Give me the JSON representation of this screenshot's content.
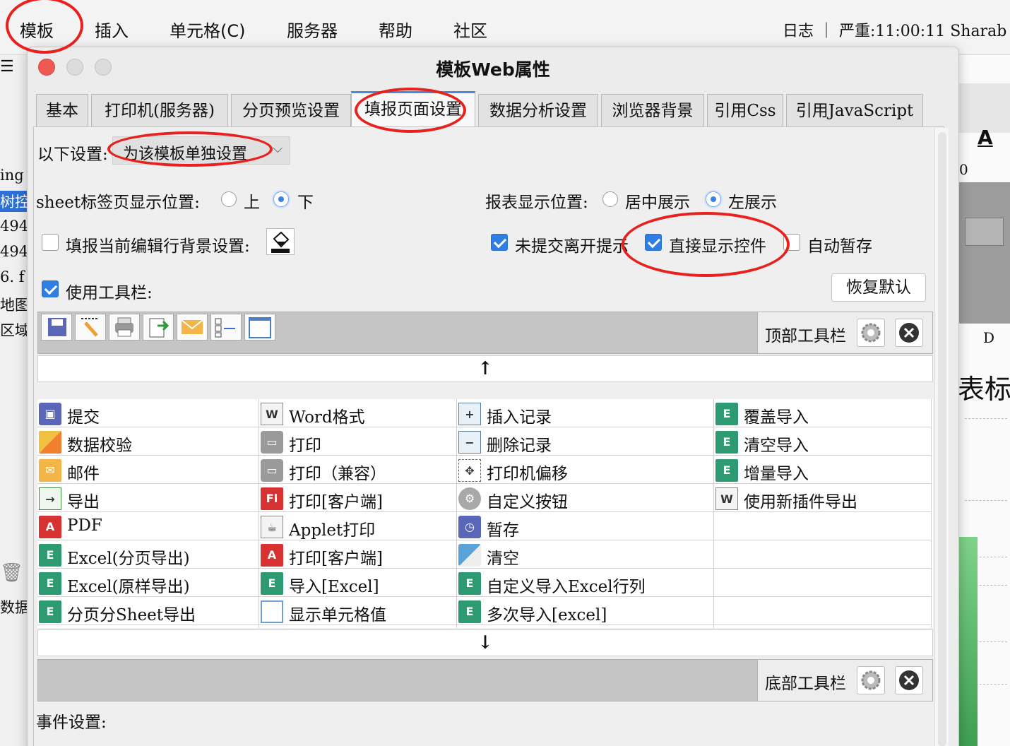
{
  "menubar": {
    "items": [
      "模板",
      "插入",
      "单元格(C)",
      "服务器",
      "帮助",
      "社区"
    ],
    "right_text": "日志 ｜ 严重:11:00:11 Sharab"
  },
  "background": {
    "left_fragments": [
      "ing",
      "树控",
      "494",
      "494",
      "6. f",
      "地图",
      "区域",
      "数据"
    ],
    "right_fragments": [
      "A",
      "0",
      "D",
      "表标题"
    ]
  },
  "dialog": {
    "title": "模板Web属性",
    "tabs": [
      "基本",
      "打印机(服务器)",
      "分页预览设置",
      "填报页面设置",
      "数据分析设置",
      "浏览器背景",
      "引用Css",
      "引用JavaScript"
    ],
    "active_tab": "填报页面设置"
  },
  "settings": {
    "scope_label": "以下设置:",
    "scope_value": "为该模板单独设置",
    "sheet_pos_label": "sheet标签页显示位置:",
    "sheet_pos_up": "上",
    "sheet_pos_down": "下",
    "sheet_pos_selected": "下",
    "report_pos_label": "报表显示位置:",
    "report_center": "居中展示",
    "report_left": "左展示",
    "report_selected": "左展示",
    "bg_setting_label": "填报当前编辑行背景设置:",
    "bg_setting_checked": false,
    "leave_prompt_label": "未提交离开提示",
    "leave_prompt_checked": true,
    "direct_show_label": "直接显示控件",
    "direct_show_checked": true,
    "auto_save_label": "自动暂存",
    "auto_save_checked": false,
    "use_toolbar_label": "使用工具栏:",
    "use_toolbar_checked": true,
    "restore_default": "恢复默认"
  },
  "top_toolbar": {
    "label": "顶部工具栏",
    "icons": [
      "save-icon",
      "validate-icon",
      "print-icon",
      "export-icon",
      "mail-icon",
      "insert-record-icon",
      "cell-value-icon"
    ]
  },
  "bottom_toolbar": {
    "label": "底部工具栏"
  },
  "arrows": {
    "up": "↑",
    "down": "↓"
  },
  "buttons_grid": [
    [
      {
        "label": "提交",
        "icon": "save-icon"
      },
      {
        "label": "数据校验",
        "icon": "pencil-icon"
      },
      {
        "label": "邮件",
        "icon": "mail-icon"
      },
      {
        "label": "导出",
        "icon": "export-icon"
      },
      {
        "label": "PDF",
        "icon": "pdf-icon"
      },
      {
        "label": "Excel(分页导出)",
        "icon": "excel-icon"
      },
      {
        "label": "Excel(原样导出)",
        "icon": "excel-icon"
      },
      {
        "label": "分页分Sheet导出",
        "icon": "excel-icon"
      }
    ],
    [
      {
        "label": "Word格式",
        "icon": "word-icon"
      },
      {
        "label": "打印",
        "icon": "printer-icon"
      },
      {
        "label": "打印（兼容）",
        "icon": "printer-icon"
      },
      {
        "label": "打印[客户端]",
        "icon": "flash-print-icon"
      },
      {
        "label": "Applet打印",
        "icon": "applet-icon"
      },
      {
        "label": "打印[客户端]",
        "icon": "pdf-print-icon"
      },
      {
        "label": "导入[Excel]",
        "icon": "excel-icon"
      },
      {
        "label": "显示单元格值",
        "icon": "cell-icon"
      }
    ],
    [
      {
        "label": "插入记录",
        "icon": "insert-row-icon"
      },
      {
        "label": "删除记录",
        "icon": "delete-row-icon"
      },
      {
        "label": "打印机偏移",
        "icon": "move-icon"
      },
      {
        "label": "自定义按钮",
        "icon": "gear-icon"
      },
      {
        "label": "暂存",
        "icon": "save-clock-icon"
      },
      {
        "label": "清空",
        "icon": "eraser-icon"
      },
      {
        "label": "自定义导入Excel行列",
        "icon": "excel-icon"
      },
      {
        "label": "多次导入[excel]",
        "icon": "excel-icon"
      }
    ],
    [
      {
        "label": "覆盖导入",
        "icon": "excel-icon"
      },
      {
        "label": "清空导入",
        "icon": "excel-icon"
      },
      {
        "label": "增量导入",
        "icon": "excel-icon"
      },
      {
        "label": "使用新插件导出",
        "icon": "word-icon"
      }
    ]
  ],
  "event_settings_label": "事件设置:",
  "colors": {
    "accent": "#2f7ee3",
    "annotation": "#e8211e",
    "excel": "#2d9a72"
  }
}
